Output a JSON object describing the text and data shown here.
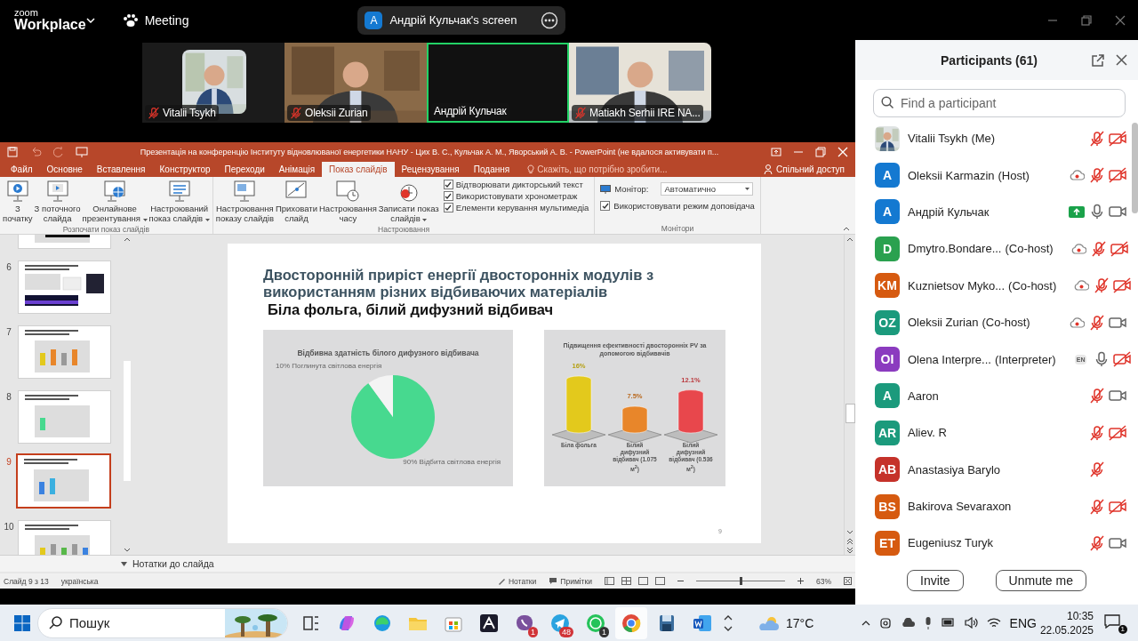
{
  "zoom": {
    "logo_top": "zoom",
    "logo_bottom": "Workplace",
    "meeting_label": "Meeting",
    "share": {
      "badge": "A",
      "title": "Андрій Кульчак's screen"
    }
  },
  "video_tiles": [
    {
      "name": "Vitalii Tsykh",
      "kind": "avatar",
      "muted": true,
      "speaking": false
    },
    {
      "name": "Oleksii Zurian",
      "kind": "camera",
      "muted": true,
      "speaking": false
    },
    {
      "name": "Андрій Кульчак",
      "kind": "blank",
      "muted": false,
      "speaking": true
    },
    {
      "name": "Matiakh Serhii IRE NA...",
      "kind": "camera",
      "muted": true,
      "speaking": false
    }
  ],
  "powerpoint": {
    "title": "Презентація на конференцію Інституту відновлюваної енергетики НАНУ - Цих В. С., Кульчак А. М., Яворський А. В. - PowerPoint (не вдалося активувати п...",
    "tabs": [
      {
        "label": "Файл",
        "selected": false
      },
      {
        "label": "Основне",
        "selected": false
      },
      {
        "label": "Вставлення",
        "selected": false
      },
      {
        "label": "Конструктор",
        "selected": false
      },
      {
        "label": "Переходи",
        "selected": false
      },
      {
        "label": "Анімація",
        "selected": false
      },
      {
        "label": "Показ слайдів",
        "selected": true
      },
      {
        "label": "Рецензування",
        "selected": false
      },
      {
        "label": "Подання",
        "selected": false
      }
    ],
    "tell_me": "Скажіть, що потрібно зробити...",
    "share": "Спільний доступ",
    "ribbon_groups": [
      {
        "label": "Розпочати показ слайдів",
        "items": [
          {
            "kind": "button",
            "lines": [
              "З",
              "початку"
            ],
            "dropdown": false
          },
          {
            "kind": "button",
            "lines": [
              "З поточного",
              "слайда"
            ],
            "dropdown": false
          },
          {
            "kind": "button",
            "lines": [
              "Онлайнове",
              "презентування"
            ],
            "dropdown": true
          },
          {
            "kind": "button",
            "lines": [
              "Настроюваний",
              "показ слайдів"
            ],
            "dropdown": true
          }
        ]
      },
      {
        "label": "Настроювання",
        "items": [
          {
            "kind": "button",
            "lines": [
              "Настроювання",
              "показу слайдів"
            ],
            "dropdown": false
          },
          {
            "kind": "button",
            "lines": [
              "Приховати",
              "слайд"
            ],
            "dropdown": false
          },
          {
            "kind": "button",
            "lines": [
              "Настроювання",
              "часу"
            ],
            "dropdown": false
          },
          {
            "kind": "button",
            "lines": [
              "Записати показ",
              "слайдів"
            ],
            "dropdown": true
          },
          {
            "kind": "checks",
            "checks": [
              {
                "label": "Відтворювати дикторський текст",
                "checked": true
              },
              {
                "label": "Використовувати хронометраж",
                "checked": true
              },
              {
                "label": "Елементи керування мультимедіа",
                "checked": true
              }
            ]
          }
        ]
      },
      {
        "label": "Монітори",
        "items": [
          {
            "kind": "monitor",
            "label": "Монітор:",
            "value": "Автоматично",
            "check": {
              "label": "Використовувати режим доповідача",
              "checked": true
            }
          }
        ]
      }
    ],
    "thumbnails": [
      {
        "number": "6",
        "selected": false
      },
      {
        "number": "7",
        "selected": false
      },
      {
        "number": "8",
        "selected": false
      },
      {
        "number": "9",
        "selected": true
      },
      {
        "number": "10",
        "selected": false
      }
    ],
    "slide": {
      "title": "Двосторонній приріст енергії двосторонніх модулів з використанням різних відбиваючих матеріалів",
      "subtitle": "Біла фольга, білий дифузний відбивач",
      "page_number": "9",
      "charts": [
        {
          "chart_data": {
            "type": "pie",
            "title": "Відбивна здатність білого дифузного відбивача",
            "categories": [
              "Відбита світлова енергія",
              "Поглинута світлова енергія"
            ],
            "values": [
              90,
              10
            ],
            "colors": [
              "#47d98f",
              "#f4f4f4"
            ],
            "value_labels": [
              "90%",
              "10%"
            ]
          }
        },
        {
          "chart_data": {
            "type": "bar",
            "title": "Підвищення ефективності двосторонніх PV за допомогою відбивачів",
            "categories": [
              "Біла фольга",
              "Білий дифузний відбивач (1.075 м$^{2}$)",
              "Білий дифузний відбивач (0.536 м$^{2}$)"
            ],
            "values": [
              16,
              7.5,
              12.1
            ],
            "colors": [
              "#e3c91c",
              "#e8862a",
              "#e8474c"
            ],
            "value_labels": [
              "16%",
              "7.5%",
              "12.1%"
            ]
          }
        }
      ]
    },
    "notes_label": "Нотатки до слайда",
    "status": {
      "slide_info": "Слайд 9 з 13",
      "language": "українська",
      "notes": "Нотатки",
      "comments": "Примітки",
      "zoom": {
        "level": 0.5,
        "reading": "63%"
      }
    }
  },
  "participants_panel": {
    "title": "Participants (61)",
    "search": {
      "placeholder": "Find a participant"
    },
    "participants": [
      {
        "name": "Vitalii Tsykh",
        "role": "(Me)",
        "muted": true,
        "camera_off": true
      },
      {
        "name": "Oleksii Karmazin",
        "role": "(Host)",
        "avatar": {
          "kind": "initials",
          "initials": "A",
          "color": "#1479d1"
        },
        "badge": {
          "kind": "recording"
        },
        "muted": true,
        "camera_off": true
      },
      {
        "name": "Андрій Кульчак",
        "avatar": {
          "kind": "initials",
          "initials": "A",
          "color": "#1479d1"
        },
        "badge": {
          "kind": "sharing"
        },
        "muted": false,
        "camera_off": false
      },
      {
        "name": "Dmytro.Bondare...",
        "role": "(Co-host)",
        "avatar": {
          "kind": "initials",
          "initials": "D",
          "color": "#2aa14f"
        },
        "badge": {
          "kind": "recording"
        },
        "muted": true,
        "camera_off": true
      },
      {
        "name": "Kuznietsov Myko...",
        "role": "(Co-host)",
        "avatar": {
          "kind": "initials",
          "initials": "KM",
          "color": "#d65a10"
        },
        "badge": {
          "kind": "recording"
        },
        "muted": true,
        "camera_off": true
      },
      {
        "name": "Oleksii Zurian",
        "role": "(Co-host)",
        "avatar": {
          "kind": "initials",
          "initials": "OZ",
          "color": "#1b9a7c"
        },
        "badge": {
          "kind": "recording"
        },
        "muted": true,
        "camera_off": false
      },
      {
        "name": "Olena Interpre...",
        "role": "(Interpreter)",
        "avatar": {
          "kind": "initials",
          "initials": "OI",
          "color": "#8b3bbf"
        },
        "badge": {
          "kind": "language",
          "text": "EN"
        },
        "muted": false,
        "camera_off": true
      },
      {
        "name": "Aaron",
        "avatar": {
          "kind": "initials",
          "initials": "A",
          "color": "#1b9a7c"
        },
        "muted": true,
        "camera_off": false
      },
      {
        "name": "Aliev. R",
        "avatar": {
          "kind": "initials",
          "initials": "AR",
          "color": "#1b9a7c"
        },
        "muted": true,
        "camera_off": true
      },
      {
        "name": "Anastasiya Barylo",
        "avatar": {
          "kind": "initials",
          "initials": "AB",
          "color": "#c5322a"
        },
        "muted": true
      },
      {
        "name": "Bakirova Sevaraxon",
        "avatar": {
          "kind": "initials",
          "initials": "BS",
          "color": "#d65a10"
        },
        "muted": true,
        "camera_off": true
      },
      {
        "name": "Eugeniusz Turyk",
        "avatar": {
          "kind": "initials",
          "initials": "ET",
          "color": "#d65a10"
        },
        "muted": true,
        "camera_off": false
      }
    ],
    "buttons": [
      "Invite",
      "Unmute me"
    ]
  },
  "taskbar": {
    "search": {
      "placeholder": "Пошук"
    },
    "apps": [
      {
        "kind": "taskview",
        "active": false
      },
      {
        "kind": "copilot",
        "active": false
      },
      {
        "kind": "edge",
        "active": false
      },
      {
        "kind": "explorer",
        "active": false
      },
      {
        "kind": "store",
        "active": false
      },
      {
        "kind": "acrobat",
        "active": false
      },
      {
        "kind": "viber",
        "badge": "1",
        "active": false
      },
      {
        "kind": "telegram",
        "badge": "48",
        "active": false
      },
      {
        "kind": "whatsapp",
        "badge": "1",
        "active": false
      },
      {
        "kind": "chrome",
        "active": true
      },
      {
        "kind": "disk",
        "active": false
      },
      {
        "kind": "word",
        "active": false
      }
    ],
    "weather": "17°C",
    "language": "ENG",
    "time": "10:35",
    "date": "22.05.2025",
    "notifications": "1"
  }
}
